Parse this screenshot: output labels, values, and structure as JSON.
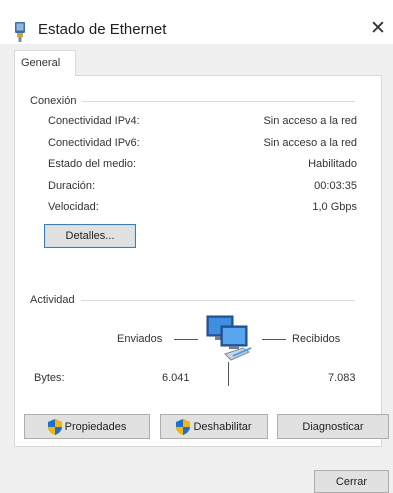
{
  "window": {
    "title": "Estado de Ethernet",
    "icon": "network-adapter-icon",
    "close_glyph": "✕"
  },
  "tabs": [
    {
      "label": "General"
    }
  ],
  "connection": {
    "section_label": "Conexión",
    "rows": [
      {
        "label": "Conectividad IPv4:",
        "value": "Sin acceso a la red"
      },
      {
        "label": "Conectividad IPv6:",
        "value": "Sin acceso a la red"
      },
      {
        "label": "Estado del medio:",
        "value": "Habilitado"
      },
      {
        "label": "Duración:",
        "value": "00:03:35"
      },
      {
        "label": "Velocidad:",
        "value": "1,0 Gbps"
      }
    ],
    "details_button": "Detalles..."
  },
  "activity": {
    "section_label": "Actividad",
    "sent_label": "Enviados",
    "received_label": "Recibidos",
    "bytes_label": "Bytes:",
    "bytes_sent": "6.041",
    "bytes_received": "7.083"
  },
  "buttons": {
    "properties": "Propiedades",
    "disable": "Deshabilitar",
    "diagnose": "Diagnosticar",
    "close": "Cerrar"
  },
  "colors": {
    "shield_blue": "#1c6fd1",
    "shield_yellow": "#f2b705",
    "accent_border": "#3c7fb1"
  }
}
